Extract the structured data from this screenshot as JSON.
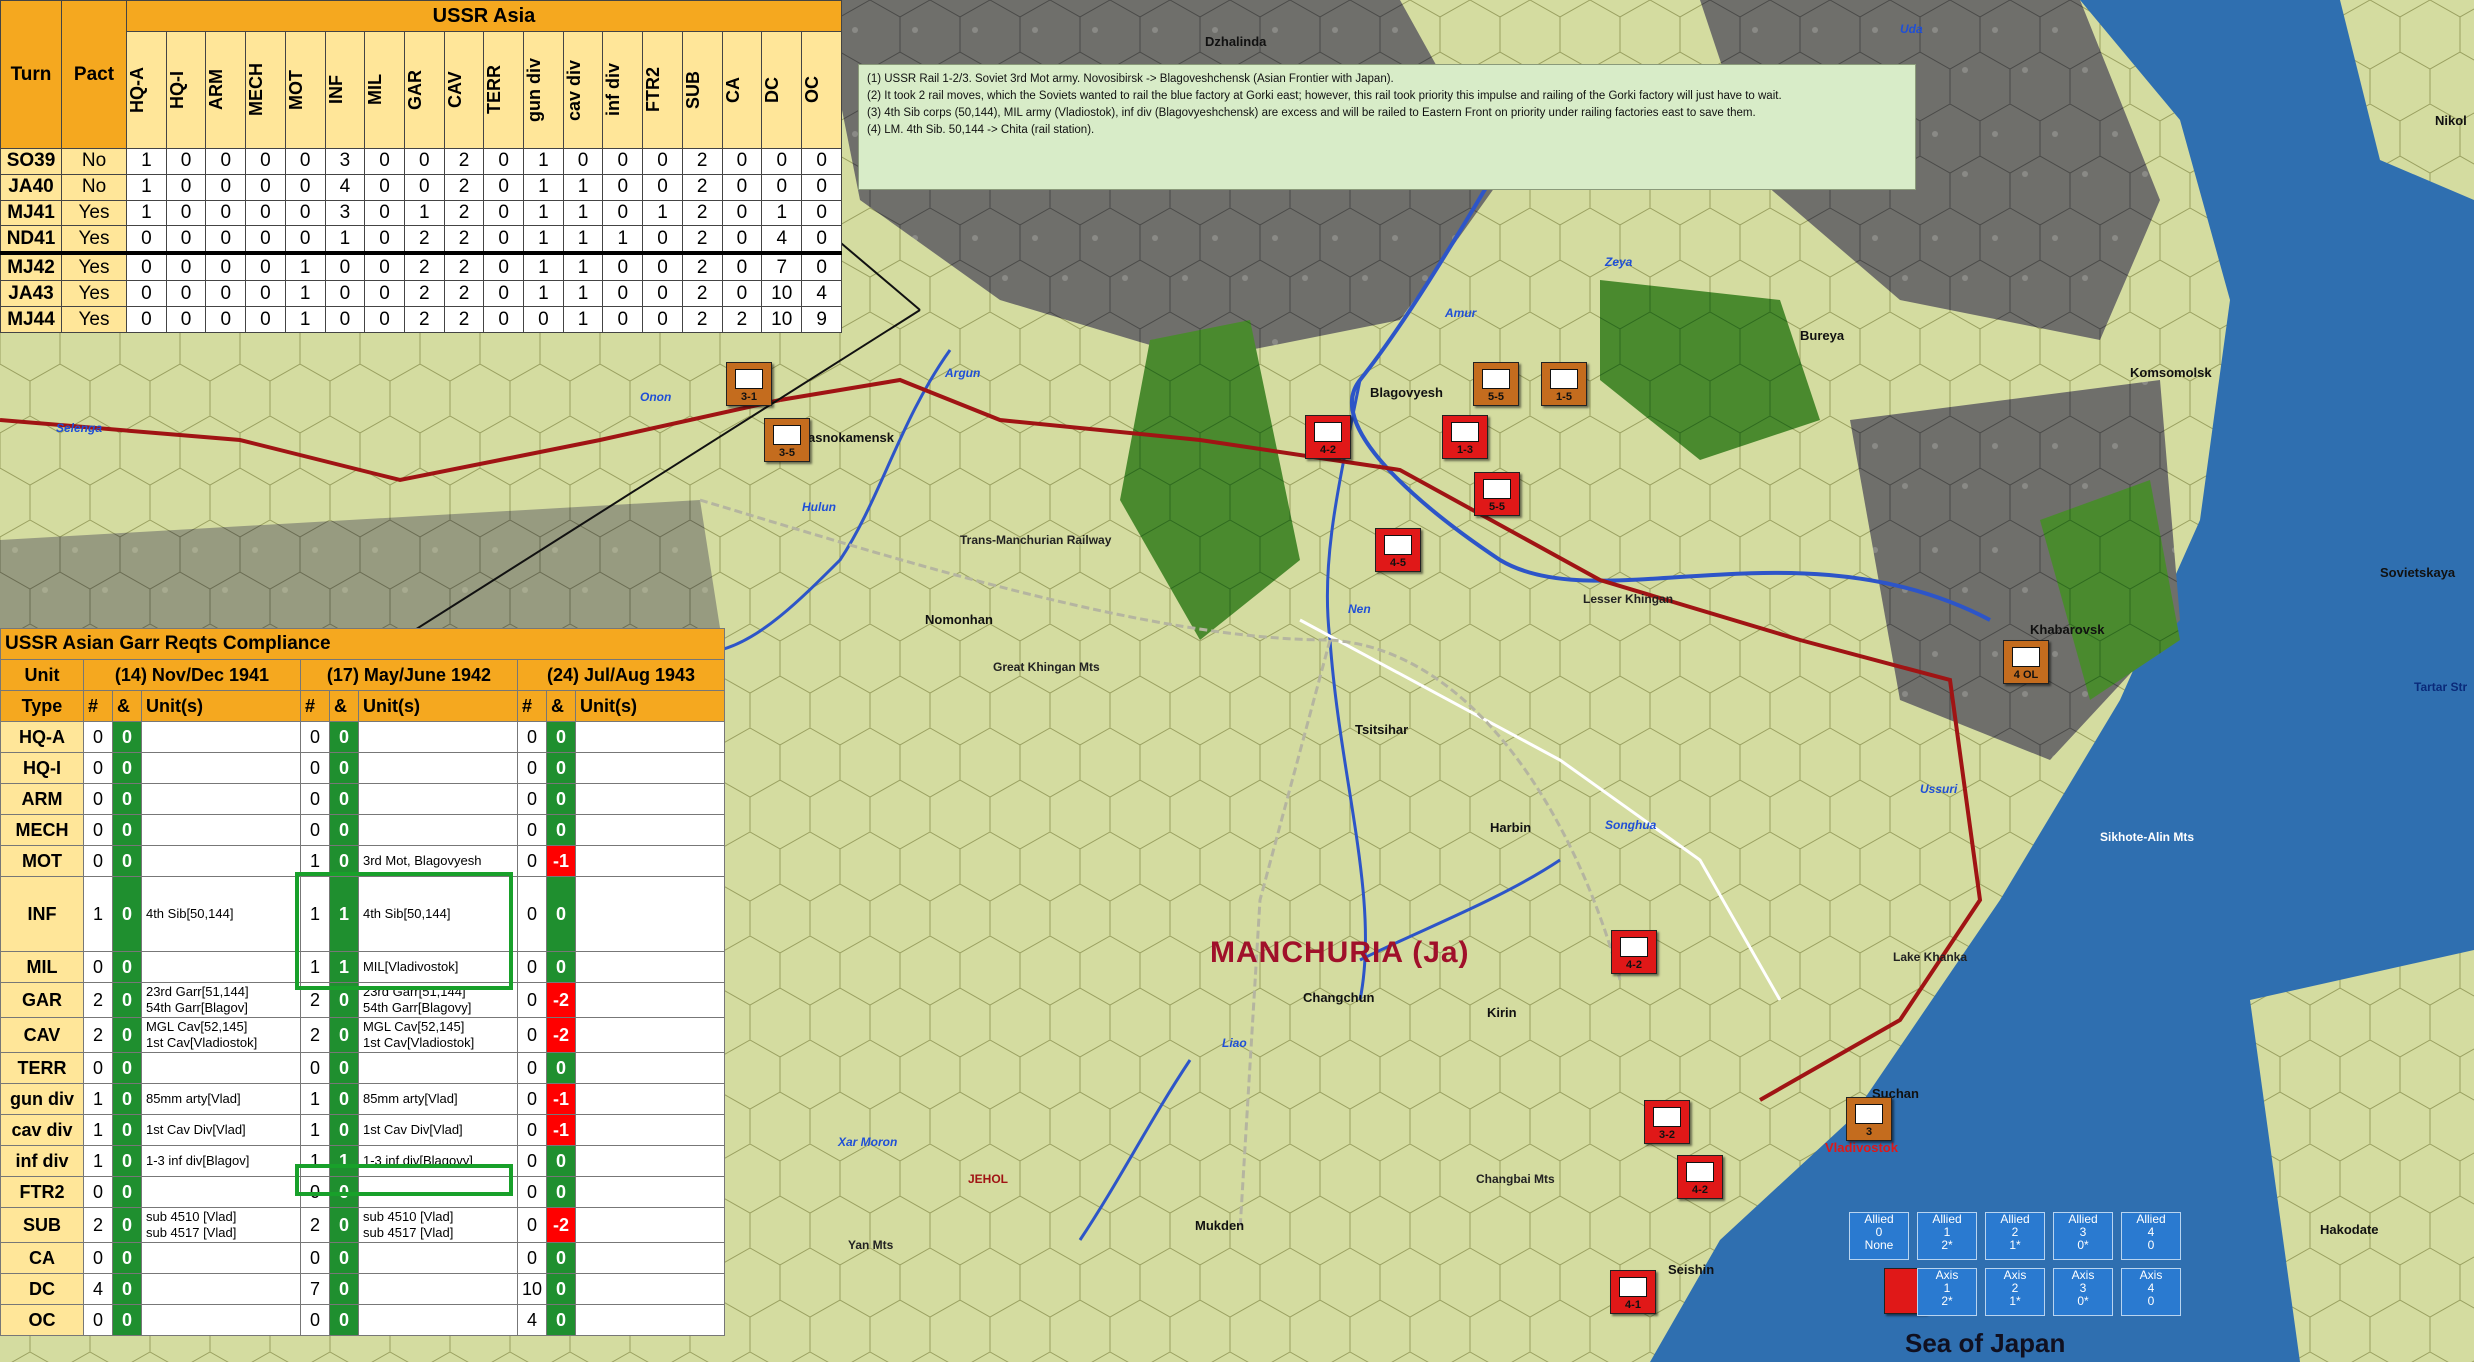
{
  "colors": {
    "sea": "#2f6fb0",
    "table_header": "#f5a81f",
    "table_yellow": "#ffe699",
    "green_ok": "#1f8f2f",
    "red_deficit": "#ff0000",
    "notes_bg": "#d8ecc8"
  },
  "ussr_asia": {
    "title": "USSR Asia",
    "turn_header": "Turn",
    "pact_header": "Pact",
    "columns": [
      "HQ-A",
      "HQ-I",
      "ARM",
      "MECH",
      "MOT",
      "INF",
      "MIL",
      "GAR",
      "CAV",
      "TERR",
      "gun div",
      "cav div",
      "inf div",
      "FTR2",
      "SUB",
      "CA",
      "DC",
      "OC"
    ],
    "rows": [
      {
        "turn": "SO39",
        "pact": "No",
        "values": [
          "1",
          "0",
          "0",
          "0",
          "0",
          "3",
          "0",
          "0",
          "2",
          "0",
          "1",
          "0",
          "0",
          "0",
          "2",
          "0",
          "0",
          "0"
        ]
      },
      {
        "turn": "JA40",
        "pact": "No",
        "values": [
          "1",
          "0",
          "0",
          "0",
          "0",
          "4",
          "0",
          "0",
          "2",
          "0",
          "1",
          "1",
          "0",
          "0",
          "2",
          "0",
          "0",
          "0"
        ]
      },
      {
        "turn": "MJ41",
        "pact": "Yes",
        "values": [
          "1",
          "0",
          "0",
          "0",
          "0",
          "3",
          "0",
          "1",
          "2",
          "0",
          "1",
          "1",
          "0",
          "1",
          "2",
          "0",
          "1",
          "0"
        ]
      },
      {
        "turn": "ND41",
        "pact": "Yes",
        "values": [
          "0",
          "0",
          "0",
          "0",
          "0",
          "1",
          "0",
          "2",
          "2",
          "0",
          "1",
          "1",
          "1",
          "0",
          "2",
          "0",
          "4",
          "0"
        ]
      },
      {
        "turn": "MJ42",
        "pact": "Yes",
        "values": [
          "0",
          "0",
          "0",
          "0",
          "1",
          "0",
          "0",
          "2",
          "2",
          "0",
          "1",
          "1",
          "0",
          "0",
          "2",
          "0",
          "7",
          "0"
        ]
      },
      {
        "turn": "JA43",
        "pact": "Yes",
        "values": [
          "0",
          "0",
          "0",
          "0",
          "1",
          "0",
          "0",
          "2",
          "2",
          "0",
          "1",
          "1",
          "0",
          "0",
          "2",
          "0",
          "10",
          "4"
        ]
      },
      {
        "turn": "MJ44",
        "pact": "Yes",
        "values": [
          "0",
          "0",
          "0",
          "0",
          "1",
          "0",
          "0",
          "2",
          "2",
          "0",
          "0",
          "1",
          "0",
          "0",
          "2",
          "2",
          "10",
          "9"
        ]
      }
    ]
  },
  "notes": [
    "(1) USSR Rail 1-2/3.  Soviet 3rd Mot army.  Novosibirsk -> Blagoveshchensk (Asian Frontier with Japan).",
    "(2) It took 2 rail moves, which the Soviets wanted to rail the blue factory at Gorki east; however, this rail took priority this impulse and railing of the Gorki factory will just have to wait.",
    "(3) 4th Sib corps (50,144), MIL army (Vladiostok), inf div (Blagovyeshchensk) are excess and will be railed to Eastern Front on priority under railing factories east to save them.",
    "(4) LM.  4th Sib. 50,144 -> Chita (rail station)."
  ],
  "compliance": {
    "title": "USSR Asian Garr Reqts Compliance",
    "unit_header": "Unit",
    "type_header": "Type",
    "periods": [
      "(14) Nov/Dec 1941",
      "(17) May/June 1942",
      "(24) Jul/Aug 1943"
    ],
    "sub_hash": "#",
    "sub_amp": "&",
    "sub_units": "Unit(s)",
    "rows": [
      {
        "type": "HQ-A",
        "a": [
          "0",
          "0",
          ""
        ],
        "b": [
          "0",
          "0",
          ""
        ],
        "c": [
          "0",
          "0",
          ""
        ]
      },
      {
        "type": "HQ-I",
        "a": [
          "0",
          "0",
          ""
        ],
        "b": [
          "0",
          "0",
          ""
        ],
        "c": [
          "0",
          "0",
          ""
        ]
      },
      {
        "type": "ARM",
        "a": [
          "0",
          "0",
          ""
        ],
        "b": [
          "0",
          "0",
          ""
        ],
        "c": [
          "0",
          "0",
          ""
        ]
      },
      {
        "type": "MECH",
        "a": [
          "0",
          "0",
          ""
        ],
        "b": [
          "0",
          "0",
          ""
        ],
        "c": [
          "0",
          "0",
          ""
        ]
      },
      {
        "type": "MOT",
        "a": [
          "0",
          "0",
          ""
        ],
        "b": [
          "1",
          "0",
          "3rd Mot, Blagovyesh"
        ],
        "c": [
          "0",
          "-1",
          ""
        ]
      },
      {
        "type": "INF",
        "a": [
          "1",
          "0",
          "4th Sib[50,144]"
        ],
        "b": [
          "1",
          "1",
          "4th Sib[50,144]"
        ],
        "c": [
          "0",
          "0",
          ""
        ]
      },
      {
        "type": "MIL",
        "a": [
          "0",
          "0",
          ""
        ],
        "b": [
          "1",
          "1",
          "MIL[Vladivostok]"
        ],
        "c": [
          "0",
          "0",
          ""
        ]
      },
      {
        "type": "GAR",
        "a": [
          "2",
          "0",
          "23rd Garr[51,144]\n54th Garr[Blagov]"
        ],
        "b": [
          "2",
          "0",
          "23rd Garr[51,144]\n54th Garr[Blagovy]"
        ],
        "c": [
          "0",
          "-2",
          ""
        ]
      },
      {
        "type": "CAV",
        "a": [
          "2",
          "0",
          "MGL Cav[52,145]\n1st Cav[Vladiostok]"
        ],
        "b": [
          "2",
          "0",
          "MGL Cav[52,145]\n1st Cav[Vladiostok]"
        ],
        "c": [
          "0",
          "-2",
          ""
        ]
      },
      {
        "type": "TERR",
        "a": [
          "0",
          "0",
          ""
        ],
        "b": [
          "0",
          "0",
          ""
        ],
        "c": [
          "0",
          "0",
          ""
        ]
      },
      {
        "type": "gun div",
        "a": [
          "1",
          "0",
          "85mm arty[Vlad]"
        ],
        "b": [
          "1",
          "0",
          "85mm arty[Vlad]"
        ],
        "c": [
          "0",
          "-1",
          ""
        ]
      },
      {
        "type": "cav div",
        "a": [
          "1",
          "0",
          "1st Cav Div[Vlad]"
        ],
        "b": [
          "1",
          "0",
          "1st Cav Div[Vlad]"
        ],
        "c": [
          "0",
          "-1",
          ""
        ]
      },
      {
        "type": "inf div",
        "a": [
          "1",
          "0",
          "1-3 inf div[Blagov]"
        ],
        "b": [
          "1",
          "1",
          "1-3 inf div[Blagovy]"
        ],
        "c": [
          "0",
          "0",
          ""
        ]
      },
      {
        "type": "FTR2",
        "a": [
          "0",
          "0",
          ""
        ],
        "b": [
          "0",
          "0",
          ""
        ],
        "c": [
          "0",
          "0",
          ""
        ]
      },
      {
        "type": "SUB",
        "a": [
          "2",
          "0",
          "sub 4510 [Vlad]\nsub 4517 [Vlad]"
        ],
        "b": [
          "2",
          "0",
          "sub 4510 [Vlad]\nsub 4517 [Vlad]"
        ],
        "c": [
          "0",
          "-2",
          ""
        ]
      },
      {
        "type": "CA",
        "a": [
          "0",
          "0",
          ""
        ],
        "b": [
          "0",
          "0",
          ""
        ],
        "c": [
          "0",
          "0",
          ""
        ]
      },
      {
        "type": "DC",
        "a": [
          "4",
          "0",
          ""
        ],
        "b": [
          "7",
          "0",
          ""
        ],
        "c": [
          "10",
          "0",
          ""
        ]
      },
      {
        "type": "OC",
        "a": [
          "0",
          "0",
          ""
        ],
        "b": [
          "0",
          "0",
          ""
        ],
        "c": [
          "4",
          "0",
          ""
        ]
      }
    ]
  },
  "map_labels": {
    "cities": [
      "Blagovyesh",
      "Komsomolsk",
      "Khabarovsk",
      "Tsitsihar",
      "Harbin",
      "Changchun",
      "Kirin",
      "Mukden",
      "Hakodate",
      "Seishin",
      "Suchan",
      "Nikol",
      "Sovietskaya",
      "Bureya",
      "Dzhalinda",
      "Nomonhan",
      "Vladivostok",
      "asnokamensk"
    ],
    "rivers": [
      "Uda",
      "Zeya",
      "Amur",
      "Argun",
      "Onon",
      "Selenga",
      "Hulun",
      "Nen",
      "Songhua",
      "Ussuri",
      "Liao",
      "Xar Moron"
    ],
    "regions": [
      "Trans-Manchurian Railway",
      "Great Khingan Mts",
      "Lesser Khingan",
      "Sikhote-Alin Mts",
      "Lake Khanka",
      "Changbai Mts",
      "Yan Mts",
      "JEHOL",
      "Tartar Str"
    ],
    "big": "MANCHURIA (Ja)",
    "sea": "Sea of Japan"
  },
  "counters": [
    {
      "label": "3-1",
      "color": "brown"
    },
    {
      "label": "3-5",
      "color": "brown"
    },
    {
      "label": "5-5",
      "color": "brown"
    },
    {
      "label": "1-5",
      "color": "brown"
    },
    {
      "label": "4-2",
      "color": "red"
    },
    {
      "label": "1-3",
      "color": "red"
    },
    {
      "label": "5-5",
      "color": "red"
    },
    {
      "label": "4-5",
      "color": "red"
    },
    {
      "label": "4-2",
      "color": "red"
    },
    {
      "label": "3-2",
      "color": "red"
    },
    {
      "label": "4-2",
      "color": "red"
    },
    {
      "label": "4-1",
      "color": "red"
    },
    {
      "label": "4 OL",
      "color": "brown"
    },
    {
      "label": "3",
      "color": "brown"
    }
  ],
  "legend": {
    "allied": [
      {
        "title": "Allied",
        "num": "0",
        "sub": "None"
      },
      {
        "title": "Allied",
        "num": "1",
        "sub": "2*"
      },
      {
        "title": "Allied",
        "num": "2",
        "sub": "1*"
      },
      {
        "title": "Allied",
        "num": "3",
        "sub": "0*"
      },
      {
        "title": "Allied",
        "num": "4",
        "sub": "0"
      }
    ],
    "axis": [
      {
        "title": "Axis",
        "num": "1",
        "sub": "2*"
      },
      {
        "title": "Axis",
        "num": "2",
        "sub": "1*"
      },
      {
        "title": "Axis",
        "num": "3",
        "sub": "0*"
      },
      {
        "title": "Axis",
        "num": "4",
        "sub": "0"
      }
    ]
  }
}
